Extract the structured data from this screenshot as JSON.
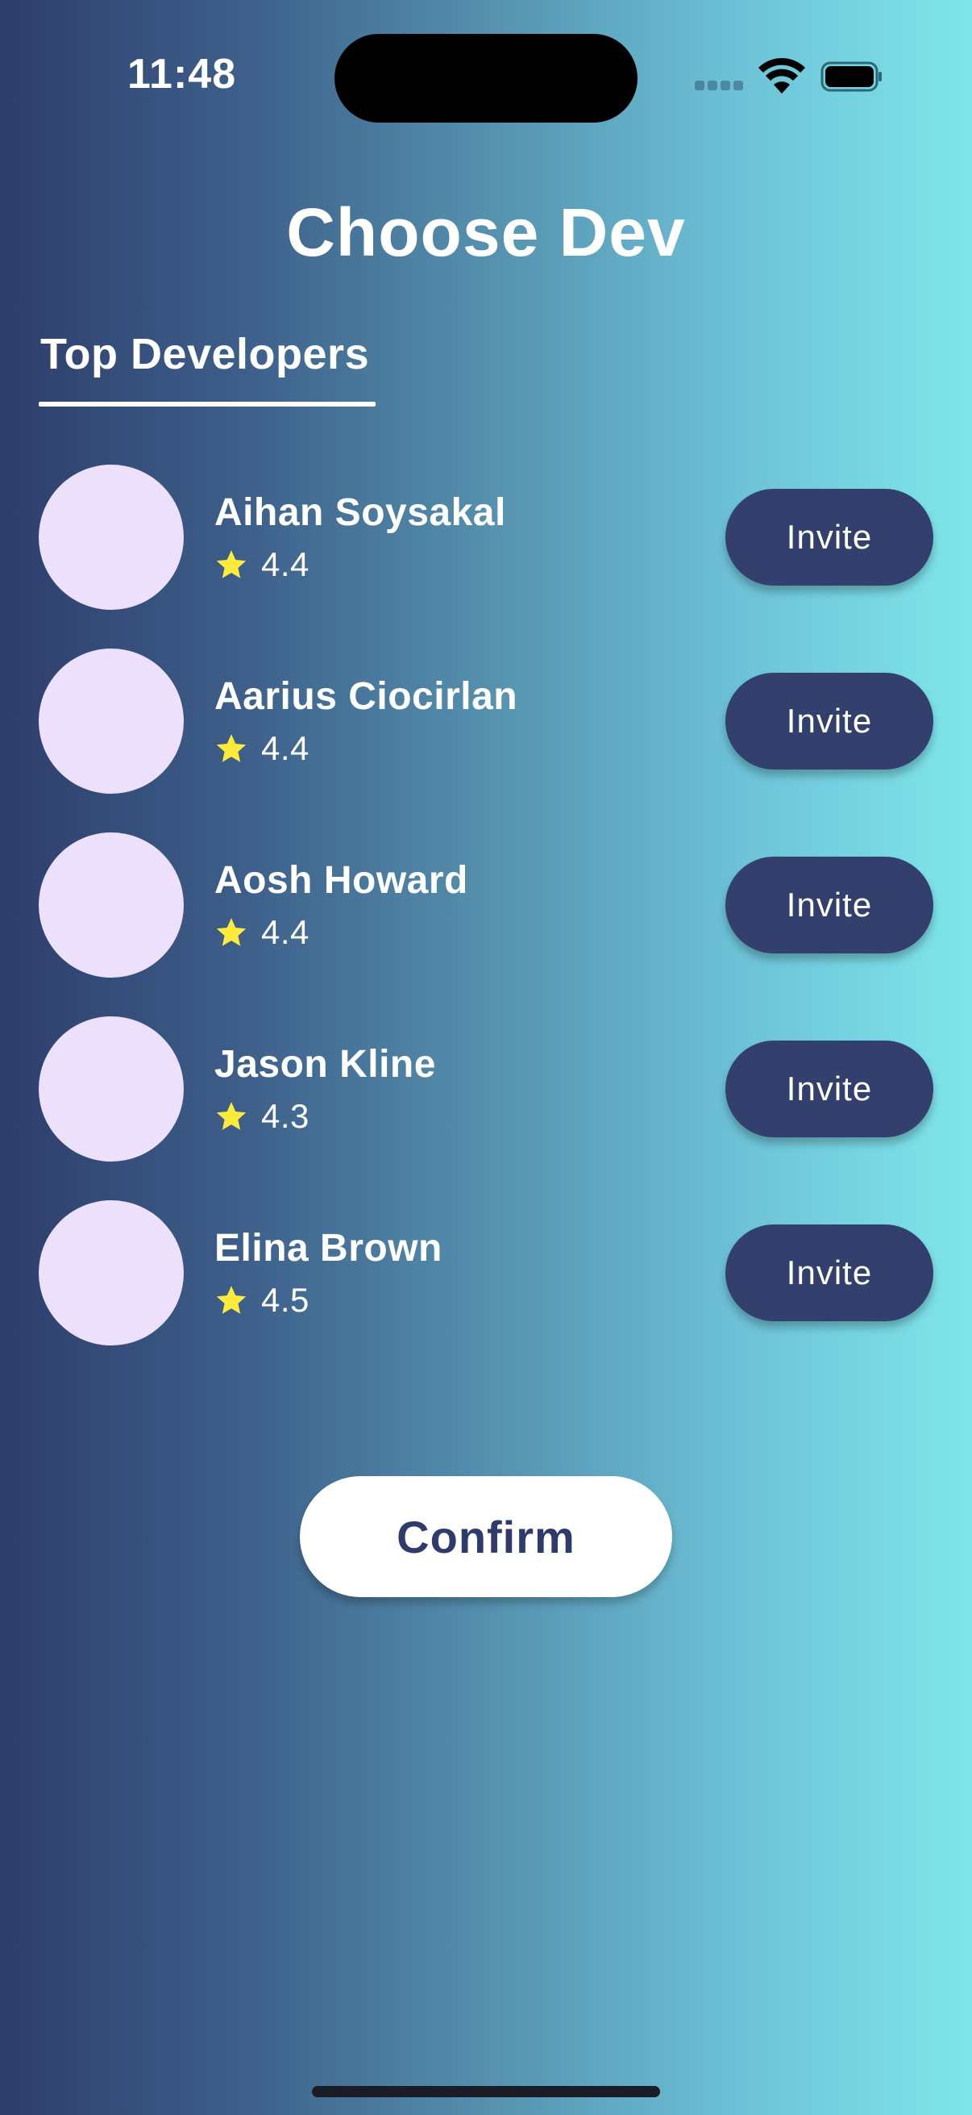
{
  "status_bar": {
    "time": "11:48",
    "icons": [
      "signal-icon",
      "wifi-icon",
      "battery-icon"
    ]
  },
  "page": {
    "title": "Choose Dev",
    "section_title": "Top Developers"
  },
  "developers": [
    {
      "name": "Aihan Soysakal",
      "rating": "4.4",
      "invite_label": "Invite"
    },
    {
      "name": "Aarius Ciocirlan",
      "rating": "4.4",
      "invite_label": "Invite"
    },
    {
      "name": "Aosh Howard",
      "rating": "4.4",
      "invite_label": "Invite"
    },
    {
      "name": "Jason Kline",
      "rating": "4.3",
      "invite_label": "Invite"
    },
    {
      "name": "Elina Brown",
      "rating": "4.5",
      "invite_label": "Invite"
    }
  ],
  "confirm_label": "Confirm",
  "colors": {
    "gradient_start": "#2e3d6b",
    "gradient_end": "#7fe6ea",
    "avatar": "#ece0fc",
    "invite_button": "#33406e",
    "star": "#ffeb3b",
    "confirm_text": "#2f3b6a"
  }
}
